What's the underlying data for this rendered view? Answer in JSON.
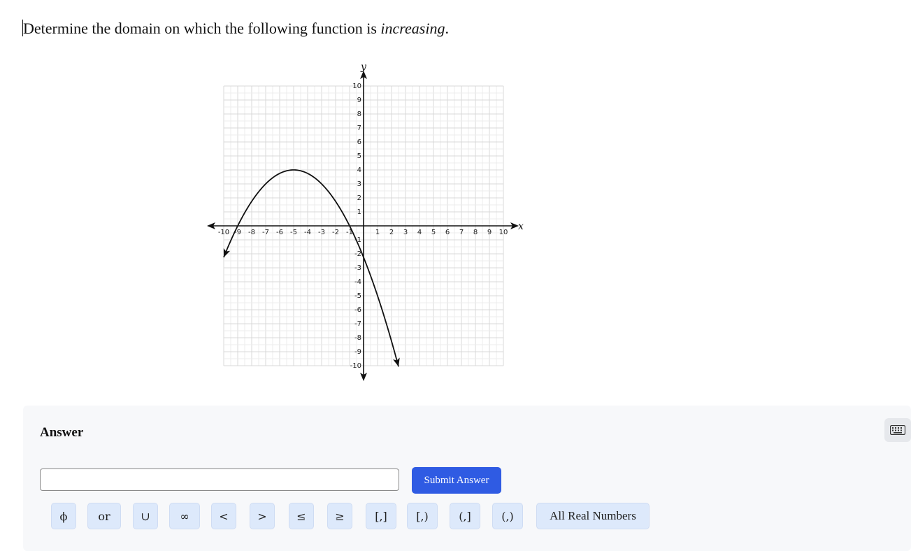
{
  "question": {
    "prefix": "Determine the domain on which the following function is ",
    "emphasis": "increasing",
    "suffix": "."
  },
  "graph": {
    "axis_labels": {
      "x": "x",
      "y": "y"
    },
    "x_range": [
      -10,
      10
    ],
    "y_range": [
      -10,
      10
    ],
    "x_ticks": [
      "-10",
      "-9",
      "-8",
      "-7",
      "-6",
      "-5",
      "-4",
      "-3",
      "-2",
      "-1",
      "1",
      "2",
      "3",
      "4",
      "5",
      "6",
      "7",
      "8",
      "9",
      "10"
    ],
    "y_ticks": [
      "10",
      "9",
      "8",
      "7",
      "6",
      "5",
      "4",
      "3",
      "2",
      "1",
      "-1",
      "-2",
      "-3",
      "-4",
      "-5",
      "-6",
      "-7",
      "-8",
      "-9",
      "-10"
    ],
    "curve": {
      "vertex": [
        -5,
        4
      ],
      "passes_through": [
        [
          -9,
          0
        ],
        [
          -1,
          0
        ],
        [
          0,
          -2
        ]
      ],
      "arrow_ends": [
        [
          -10,
          -2.3
        ],
        [
          2.5,
          -10
        ]
      ]
    }
  },
  "answer": {
    "title": "Answer",
    "input_value": "",
    "submit_label": "Submit Answer",
    "keyboard_icon": "keyboard-icon",
    "symbols": [
      {
        "label": "ϕ",
        "name": "empty-set"
      },
      {
        "label": "or",
        "name": "or"
      },
      {
        "label": "∪",
        "name": "union"
      },
      {
        "label": "∞",
        "name": "infinity"
      },
      {
        "label": "<",
        "name": "less-than"
      },
      {
        "label": ">",
        "name": "greater-than"
      },
      {
        "label": "≤",
        "name": "less-equal"
      },
      {
        "label": "≥",
        "name": "greater-equal"
      },
      {
        "label": "[,]",
        "name": "closed-interval"
      },
      {
        "label": "[,)",
        "name": "closed-open-interval"
      },
      {
        "label": "(,]",
        "name": "open-closed-interval"
      },
      {
        "label": "(,)",
        "name": "open-interval"
      },
      {
        "label": "All Real Numbers",
        "name": "all-real-numbers"
      }
    ]
  },
  "colors": {
    "submit": "#2f5be3",
    "symbol_bg": "#dde9fb",
    "panel_bg": "#f7f8fa"
  }
}
